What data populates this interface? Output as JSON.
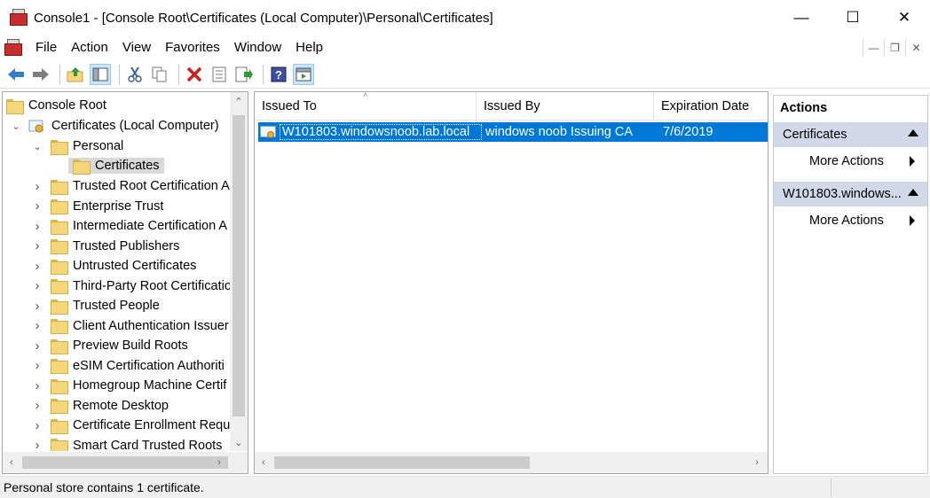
{
  "window": {
    "title": "Console1 - [Console Root\\Certificates (Local Computer)\\Personal\\Certificates]",
    "minimize": "—",
    "maximize": "☐",
    "close": "✕"
  },
  "menu": {
    "file": "File",
    "action": "Action",
    "view": "View",
    "favorites": "Favorites",
    "window": "Window",
    "help": "Help"
  },
  "tree": {
    "root": "Console Root",
    "certificates": "Certificates (Local Computer)",
    "personal": "Personal",
    "certificates_sub": "Certificates",
    "items": [
      "Trusted Root Certification A",
      "Enterprise Trust",
      "Intermediate Certification A",
      "Trusted Publishers",
      "Untrusted Certificates",
      "Third-Party Root Certificatio",
      "Trusted People",
      "Client Authentication Issuer",
      "Preview Build Roots",
      "eSIM Certification Authoriti",
      "Homegroup Machine Certif",
      "Remote Desktop",
      "Certificate Enrollment Requ",
      "Smart Card Trusted Roots"
    ]
  },
  "list": {
    "columns": [
      "Issued To",
      "Issued By",
      "Expiration Date"
    ],
    "rows": [
      {
        "issued_to": "W101803.windowsnoob.lab.local",
        "issued_by": "windows noob Issuing CA",
        "expiration": "7/6/2019"
      }
    ]
  },
  "actions": {
    "title": "Actions",
    "group1": "Certificates",
    "group1_item": "More Actions",
    "group2": "W101803.windows...",
    "group2_item": "More Actions"
  },
  "status": {
    "text": "Personal store contains 1 certificate."
  },
  "colors": {
    "selection": "#0078d7",
    "action_group": "#cfd9e7"
  }
}
